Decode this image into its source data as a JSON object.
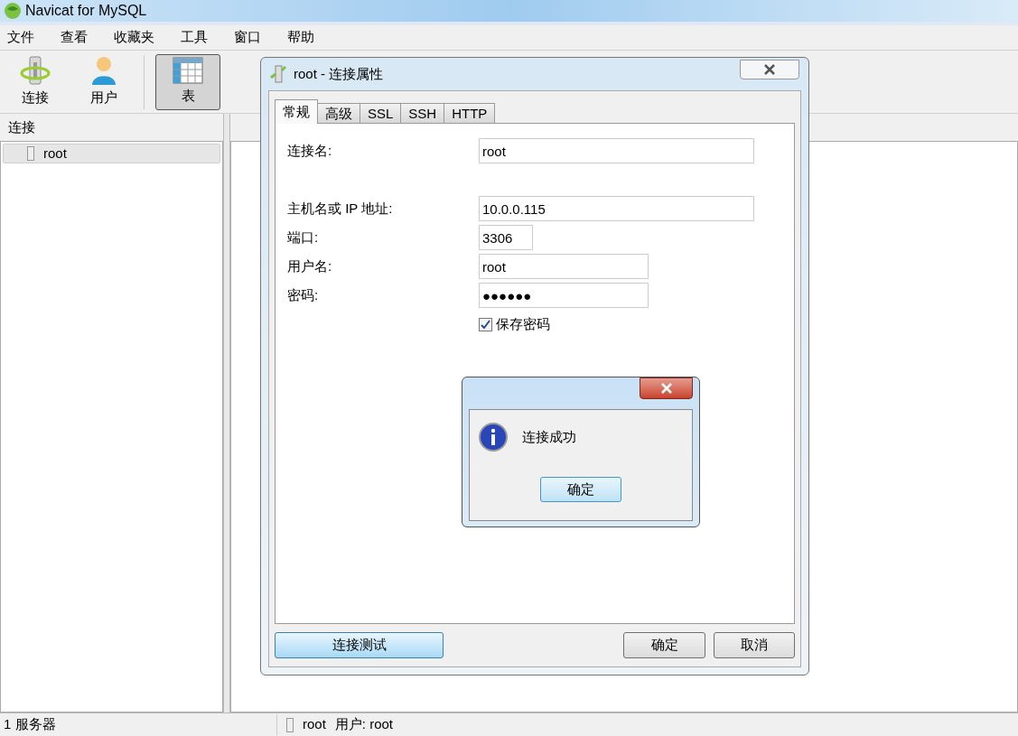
{
  "window": {
    "title": "Navicat for MySQL"
  },
  "menu": [
    "文件",
    "查看",
    "收藏夹",
    "工具",
    "窗口",
    "帮助"
  ],
  "toolbar": [
    {
      "kind": "connection",
      "label": "连接",
      "selected": false
    },
    {
      "kind": "user",
      "label": "用户",
      "selected": false
    },
    {
      "kind": "table",
      "label": "表",
      "selected": true
    }
  ],
  "sidebar": {
    "title": "连接",
    "items": [
      {
        "label": "root",
        "selected": true
      }
    ]
  },
  "status_bar": {
    "left": "1 服务器",
    "connection": "root",
    "user": "用户: root"
  },
  "dialog": {
    "title": "root - 连接属性",
    "tabs": [
      {
        "label": "常规",
        "selected": true
      },
      {
        "label": "高级",
        "selected": false
      },
      {
        "label": "SSL",
        "selected": false
      },
      {
        "label": "SSH",
        "selected": false
      },
      {
        "label": "HTTP",
        "selected": false
      }
    ],
    "fields": [
      {
        "label": "连接名:",
        "value": "root"
      },
      {
        "label": "主机名或 IP 地址:",
        "value": "10.0.0.115"
      },
      {
        "label": "端口:",
        "value": "3306"
      },
      {
        "label": "用户名:",
        "value": "root"
      },
      {
        "label": "密码:",
        "value": "●●●●●●"
      }
    ],
    "save_password": {
      "label": "保存密码",
      "checked": true
    },
    "test_button": "连接测试",
    "ok_button": "确定",
    "cancel_button": "取消"
  },
  "message": {
    "text": "连接成功",
    "ok_button": "确定"
  }
}
